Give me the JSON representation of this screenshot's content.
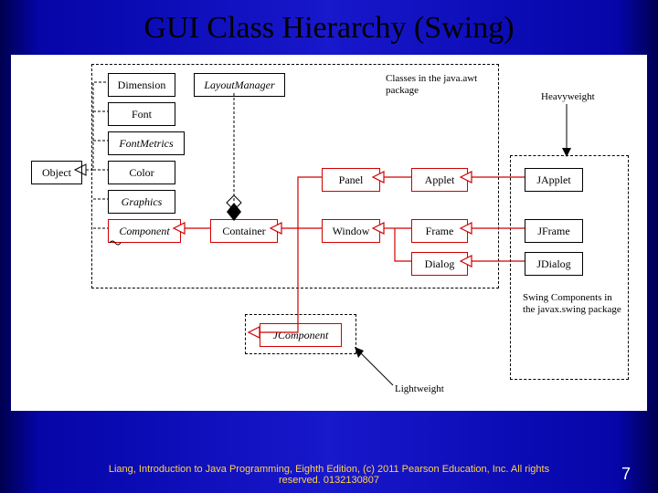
{
  "title": "GUI Class Hierarchy (Swing)",
  "boxes": {
    "object": "Object",
    "dimension": "Dimension",
    "font": "Font",
    "fontmetrics": "FontMetrics",
    "color": "Color",
    "graphics": "Graphics",
    "component": "Component",
    "layoutmanager": "LayoutManager",
    "container": "Container",
    "panel": "Panel",
    "window": "Window",
    "jcomponent": "JComponent",
    "applet": "Applet",
    "frame": "Frame",
    "dialog": "Dialog",
    "japplet": "JApplet",
    "jframe": "JFrame",
    "jdialog": "JDialog"
  },
  "labels": {
    "awt": "Classes in the java.awt package",
    "heavy": "Heavyweight",
    "light": "Lightweight",
    "swing": "Swing Components in the javax.swing package"
  },
  "footer": "Liang, Introduction to Java Programming, Eighth Edition, (c) 2011 Pearson Education, Inc. All rights reserved. 0132130807",
  "page": "7"
}
